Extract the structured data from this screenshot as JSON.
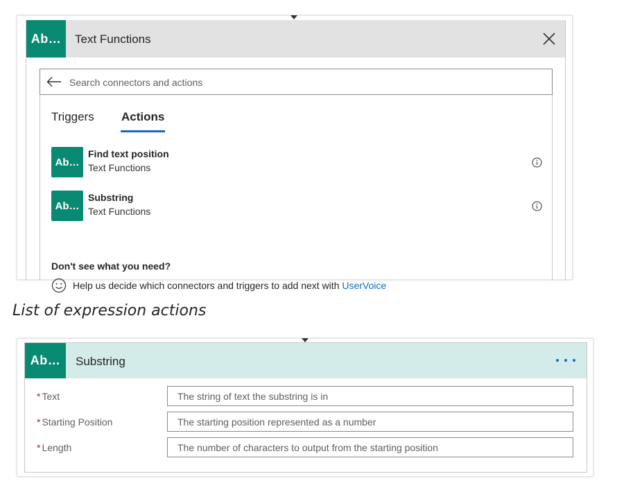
{
  "panel1": {
    "badge_text": "Ab…",
    "title": "Text Functions",
    "search": {
      "placeholder": "Search connectors and actions"
    },
    "tabs": [
      {
        "label": "Triggers",
        "active": false
      },
      {
        "label": "Actions",
        "active": true
      }
    ],
    "actions": [
      {
        "badge": "Ab…",
        "title": "Find text position",
        "subtitle": "Text Functions"
      },
      {
        "badge": "Ab…",
        "title": "Substring",
        "subtitle": "Text Functions"
      }
    ],
    "dont_see": "Don't see what you need?",
    "help_text": "Help us decide which connectors and triggers to add next with",
    "help_link": "UserVoice"
  },
  "caption": "List of expression actions",
  "panel2": {
    "badge_text": "Ab…",
    "title": "Substring",
    "fields": [
      {
        "label": "Text",
        "required": "*",
        "placeholder": "The string of text the substring is in"
      },
      {
        "label": "Starting Position",
        "required": "*",
        "placeholder": "The starting position represented as a number"
      },
      {
        "label": "Length",
        "required": "*",
        "placeholder": "The number of characters to output from the starting position"
      }
    ]
  },
  "colors": {
    "badge": "#088a72",
    "accent": "#0f6cbd",
    "header_grey": "#e2e2e2",
    "header_teal": "#d4ece9",
    "required": "#a4262c"
  },
  "icons": [
    "back-arrow-icon",
    "close-icon",
    "info-icon",
    "smile-icon",
    "more-icon",
    "caret-down-icon"
  ]
}
